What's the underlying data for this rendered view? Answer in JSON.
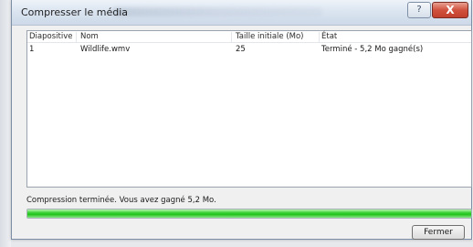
{
  "window": {
    "title": "Compresser le média",
    "help_label": "?",
    "close_label": "X"
  },
  "table": {
    "columns": [
      "Diapositive",
      "Nom",
      "Taille initiale (Mo)",
      "État"
    ],
    "rows": [
      [
        "1",
        "Wildlife.wmv",
        "25",
        "Terminé - 5,2 Mo gagné(s)"
      ]
    ]
  },
  "status": {
    "message": "Compression terminée. Vous avez gagné 5,2 Mo.",
    "progress_percent": 100,
    "progress_color": "#22c21c"
  },
  "buttons": {
    "close_label": "Fermer"
  }
}
